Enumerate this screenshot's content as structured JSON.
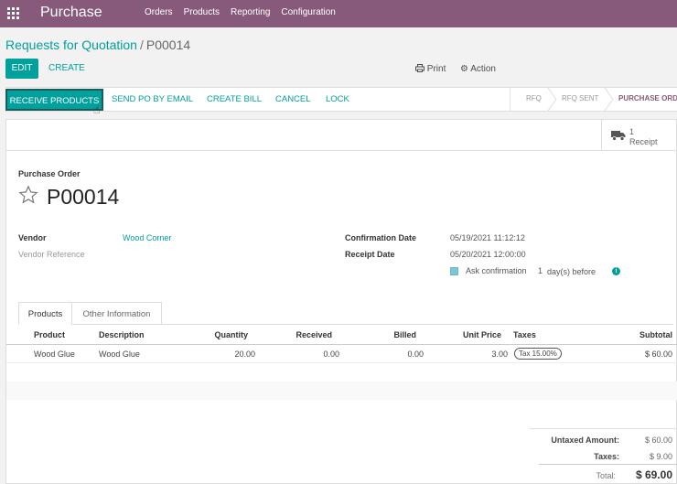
{
  "app": {
    "name": "Purchase"
  },
  "menu": [
    "Orders",
    "Products",
    "Reporting",
    "Configuration"
  ],
  "breadcrumb": {
    "parent": "Requests for Quotation",
    "separator": "/",
    "current": "P00014"
  },
  "controls": {
    "edit": "EDIT",
    "create": "CREATE",
    "print": "Print",
    "action": "Action"
  },
  "statusbar": {
    "buttons": {
      "receive": "RECEIVE PRODUCTS",
      "send": "SEND PO BY EMAIL",
      "bill": "CREATE BILL",
      "cancel": "CANCEL",
      "lock": "LOCK"
    },
    "stages": [
      "RFQ",
      "RFQ SENT",
      "PURCHASE ORDER"
    ],
    "active_stage": "PURCHASE ORDER"
  },
  "smart_button": {
    "count": "1",
    "label": "Receipt",
    "icon": "truck-icon"
  },
  "form": {
    "label": "Purchase Order",
    "name": "P00014",
    "vendor_label": "Vendor",
    "vendor": "Wood Corner",
    "vendor_ref_label": "Vendor Reference",
    "confirmation_date_label": "Confirmation Date",
    "confirmation_date": "05/19/2021 11:12:12",
    "receipt_date_label": "Receipt Date",
    "receipt_date": "05/20/2021 12:00:00",
    "ask_confirmation": "Ask confirmation",
    "ask_days": "1",
    "ask_suffix": "day(s) before"
  },
  "tabs": [
    "Products",
    "Other Information"
  ],
  "lines": {
    "headers": [
      "Product",
      "Description",
      "Quantity",
      "Received",
      "Billed",
      "Unit Price",
      "Taxes",
      "Subtotal"
    ],
    "rows": [
      {
        "product": "Wood Glue",
        "description": "Wood Glue",
        "quantity": "20.00",
        "received": "0.00",
        "billed": "0.00",
        "unit_price": "3.00",
        "taxes": "Tax 15.00%",
        "subtotal": "$ 60.00"
      }
    ]
  },
  "totals": {
    "untaxed_label": "Untaxed Amount:",
    "untaxed": "$ 60.00",
    "taxes_label": "Taxes:",
    "taxes": "$ 9.00",
    "total_label": "Total:",
    "total": "$ 69.00"
  },
  "colors": {
    "brand": "#875a7b",
    "accent": "#00a09d"
  }
}
